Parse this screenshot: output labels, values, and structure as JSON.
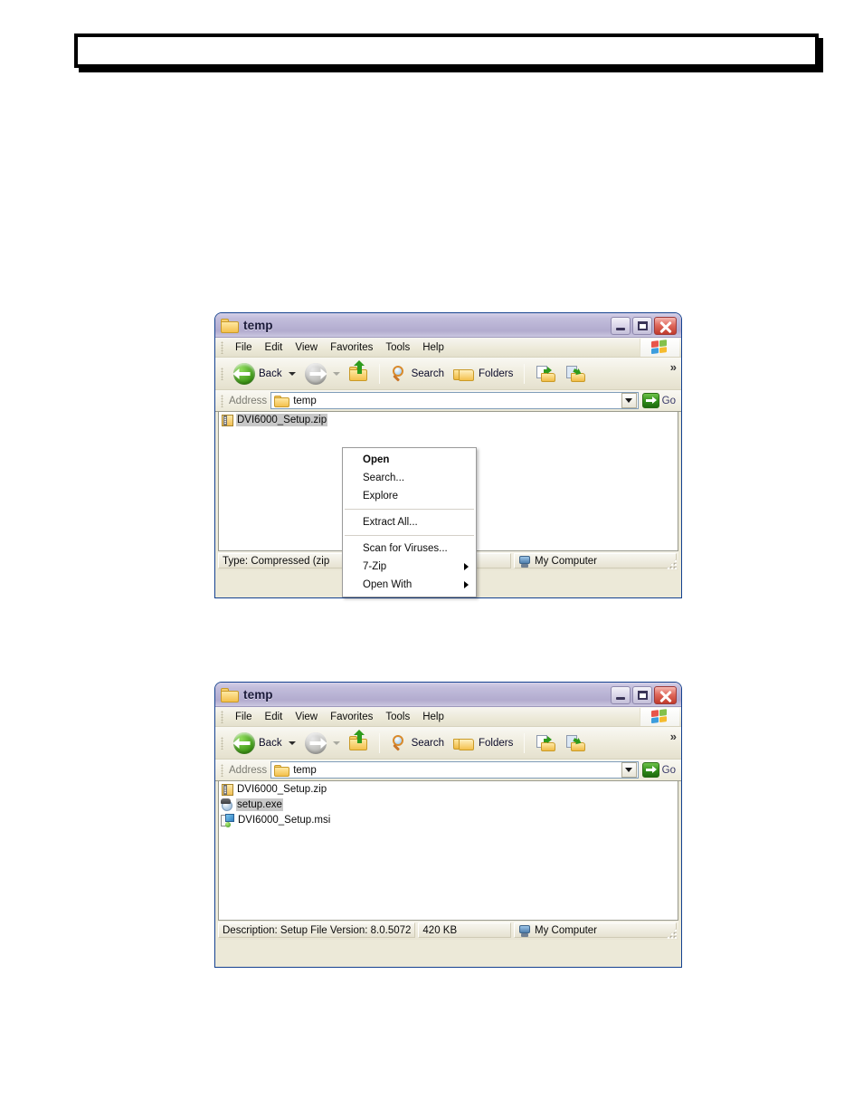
{
  "header_banner": {
    "text": ""
  },
  "window1": {
    "title": "temp",
    "title_icon": "folder-icon",
    "controls": {
      "minimize": "minimize-button",
      "maximize": "maximize-button",
      "close": "close-button"
    },
    "menu": [
      "File",
      "Edit",
      "View",
      "Favorites",
      "Tools",
      "Help"
    ],
    "toolbar": {
      "back_label": "Back",
      "search_label": "Search",
      "folders_label": "Folders",
      "overflow_label": "»"
    },
    "address": {
      "label": "Address",
      "value": "temp",
      "go_label": "Go"
    },
    "files": [
      {
        "name": "DVI6000_Setup.zip",
        "icon": "zip-file-icon",
        "selected": true
      }
    ],
    "status": {
      "info": "Type: Compressed (zip",
      "zone": "My Computer"
    },
    "context_menu": {
      "items": [
        {
          "label": "Open",
          "bold": true,
          "submenu": false
        },
        {
          "label": "Search...",
          "bold": false,
          "submenu": false
        },
        {
          "label": "Explore",
          "bold": false,
          "submenu": false
        },
        {
          "separator": true
        },
        {
          "label": "Extract All...",
          "bold": false,
          "submenu": false
        },
        {
          "separator": true
        },
        {
          "label": "Scan for Viruses...",
          "bold": false,
          "submenu": false
        },
        {
          "label": "7-Zip",
          "bold": false,
          "submenu": true
        },
        {
          "label": "Open With",
          "bold": false,
          "submenu": true
        }
      ]
    }
  },
  "window2": {
    "title": "temp",
    "title_icon": "folder-icon",
    "menu": [
      "File",
      "Edit",
      "View",
      "Favorites",
      "Tools",
      "Help"
    ],
    "toolbar": {
      "back_label": "Back",
      "search_label": "Search",
      "folders_label": "Folders",
      "overflow_label": "»"
    },
    "address": {
      "label": "Address",
      "value": "temp",
      "go_label": "Go"
    },
    "files": [
      {
        "name": "DVI6000_Setup.zip",
        "icon": "zip-file-icon",
        "selected": false
      },
      {
        "name": "setup.exe",
        "icon": "exe-file-icon",
        "selected": true
      },
      {
        "name": "DVI6000_Setup.msi",
        "icon": "msi-file-icon",
        "selected": false
      }
    ],
    "status": {
      "description": "Description: Setup File Version: 8.0.5072",
      "size": "420 KB",
      "zone": "My Computer"
    }
  },
  "colors": {
    "titlebar_start": "#d6d2e8",
    "titlebar_end": "#b2abce",
    "chrome": "#ece9d8",
    "selection": "#c8c8c8",
    "close_button": "#c03a2b",
    "go_green": "#2f8c18"
  }
}
